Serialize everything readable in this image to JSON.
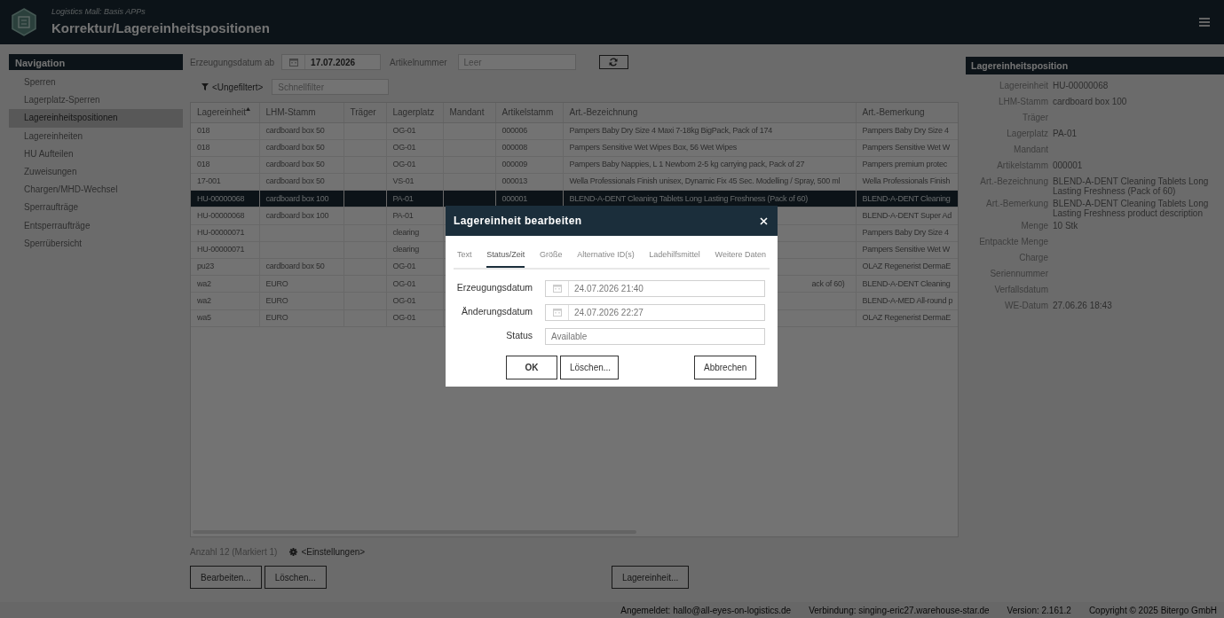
{
  "header": {
    "subtitle": "Logistics Mall: Basis APPs",
    "title": "Korrektur/Lagereinheitspositionen"
  },
  "navigation": {
    "title": "Navigation",
    "items": [
      {
        "label": "Sperren",
        "selected": false
      },
      {
        "label": "Lagerplatz-Sperren",
        "selected": false
      },
      {
        "label": "Lagereinheitspositionen",
        "selected": true
      },
      {
        "label": "Lagereinheiten",
        "selected": false
      },
      {
        "label": "HU Aufteilen",
        "selected": false
      },
      {
        "label": "Zuweisungen",
        "selected": false
      },
      {
        "label": "Chargen/MHD-Wechsel",
        "selected": false
      },
      {
        "label": "Sperraufträge",
        "selected": false
      },
      {
        "label": "Entsperraufträge",
        "selected": false
      },
      {
        "label": "Sperrübersicht",
        "selected": false
      }
    ]
  },
  "filter": {
    "date_label": "Erzeugungsdatum ab",
    "date_value": "17.07.2026",
    "article_label": "Artikelnummer",
    "article_placeholder": "Leer"
  },
  "quick_filter": {
    "link": "<Ungefiltert>",
    "placeholder": "Schnellfilter"
  },
  "table": {
    "columns": [
      {
        "label": "Lagereinheit",
        "sorted": true
      },
      {
        "label": "LHM-Stamm",
        "sorted": false
      },
      {
        "label": "Träger",
        "sorted": false
      },
      {
        "label": "Lagerplatz",
        "sorted": false
      },
      {
        "label": "Mandant",
        "sorted": false
      },
      {
        "label": "Artikelstamm",
        "sorted": false
      },
      {
        "label": "Art.-Bezeichnung",
        "sorted": false
      },
      {
        "label": "Art.-Bemerkung",
        "sorted": false
      }
    ],
    "rows": [
      {
        "selected": false,
        "cells": [
          "018",
          "cardboard box 50",
          null,
          "OG-01",
          null,
          "000006",
          "Pampers Baby Dry Size 4 Maxi 7-18kg BigPack, Pack of 174",
          "Pampers Baby Dry Size 4"
        ]
      },
      {
        "selected": false,
        "cells": [
          "018",
          "cardboard box 50",
          null,
          "OG-01",
          null,
          "000008",
          "Pampers Sensitive Wet Wipes Box, 56 Wet Wipes",
          "Pampers Sensitive Wet W"
        ]
      },
      {
        "selected": false,
        "cells": [
          "018",
          "cardboard box 50",
          null,
          "OG-01",
          null,
          "000009",
          "Pampers Baby Nappies, L 1 Newborn 2-5 kg carrying pack, Pack of 27",
          "Pampers premium protec"
        ]
      },
      {
        "selected": false,
        "cells": [
          "17-001",
          "cardboard box 50",
          null,
          "VS-01",
          null,
          "000013",
          "Wella Professionals Finish unisex, Dynamic Fix 45 Sec. Modelling / Spray, 500 ml",
          "Wella Professionals Finish"
        ]
      },
      {
        "selected": true,
        "cells": [
          "HU-00000068",
          "cardboard box 100",
          null,
          "PA-01",
          null,
          "000001",
          "BLEND-A-DENT Cleaning Tablets Long Lasting Freshness (Pack of 60)",
          "BLEND-A-DENT Cleaning"
        ]
      },
      {
        "selected": false,
        "cells": [
          "HU-00000068",
          "cardboard box 100",
          null,
          "PA-01",
          null,
          null,
          null,
          "BLEND-A-DENT Super Ad"
        ]
      },
      {
        "selected": false,
        "cells": [
          "HU-00000071",
          null,
          null,
          "clearing",
          null,
          null,
          null,
          "Pampers Baby Dry Size 4"
        ]
      },
      {
        "selected": false,
        "cells": [
          "HU-00000071",
          null,
          null,
          "clearing",
          null,
          null,
          null,
          "Pampers Sensitive Wet W"
        ]
      },
      {
        "selected": false,
        "cells": [
          "pu23",
          "cardboard box 50",
          null,
          "OG-01",
          null,
          null,
          null,
          "OLAZ Regenerist DermaE"
        ]
      },
      {
        "selected": false,
        "cells": [
          "wa2",
          "EURO",
          null,
          "OG-01",
          null,
          null,
          {
            "text": "ack of 60)",
            "clipped": true
          },
          "BLEND-A-DENT Cleaning"
        ]
      },
      {
        "selected": false,
        "cells": [
          "wa2",
          "EURO",
          null,
          "OG-01",
          null,
          null,
          null,
          "BLEND-A-MED All-round p"
        ]
      },
      {
        "selected": false,
        "cells": [
          "wa5",
          "EURO",
          null,
          "OG-01",
          null,
          null,
          null,
          "OLAZ Regenerist DermaE"
        ]
      }
    ]
  },
  "summary": {
    "count": "Anzahl 12 (Markiert 1)",
    "settings_link": "<Einstellungen>"
  },
  "actions": [
    {
      "label": "Bearbeiten...",
      "kind": "left"
    },
    {
      "label": "Löschen...",
      "kind": "left"
    },
    {
      "label": "Lagereinheit...",
      "kind": "right"
    }
  ],
  "detail": {
    "title": "Lagereinheitsposition",
    "fields": [
      {
        "label": "Lagereinheit",
        "value": "HU-00000068"
      },
      {
        "label": "LHM-Stamm",
        "value": "cardboard box 100"
      },
      {
        "label": "Träger"
      },
      {
        "label": "Lagerplatz",
        "value": "PA-01"
      },
      {
        "label": "Mandant"
      },
      {
        "label": "Artikelstamm",
        "value": "000001"
      },
      {
        "label": "Art.-Bezeichnung",
        "value": "BLEND-A-DENT Cleaning Tablets Long Lasting Freshness (Pack of 60)"
      },
      {
        "label": "Art.-Bemerkung",
        "value": "BLEND-A-DENT Cleaning Tablets Long Lasting Freshness product description"
      },
      {
        "label": "Menge",
        "value": "10 Stk"
      },
      {
        "label": "Entpackte Menge"
      },
      {
        "label": "Charge"
      },
      {
        "label": "Seriennummer"
      },
      {
        "label": "Verfallsdatum"
      },
      {
        "label": "WE-Datum",
        "value": "27.06.26 18:43"
      }
    ]
  },
  "dialog": {
    "title": "Lagereinheit bearbeiten",
    "tabs": [
      {
        "label": "Text",
        "selected": false
      },
      {
        "label": "Status/Zeit",
        "selected": true
      },
      {
        "label": "Größe",
        "selected": false
      },
      {
        "label": "Alternative ID(s)",
        "selected": false
      },
      {
        "label": "Ladehilfsmittel",
        "selected": false
      },
      {
        "label": "Weitere Daten",
        "selected": false
      }
    ],
    "fields": [
      {
        "kind": "date",
        "label": "Erzeugungsdatum",
        "value": "24.07.2026 21:40"
      },
      {
        "kind": "date",
        "label": "Änderungsdatum",
        "value": "24.07.2026 22:27"
      },
      {
        "kind": "text",
        "label": "Status",
        "value": "Available"
      }
    ],
    "buttons": [
      {
        "label": "OK",
        "kind": "default"
      },
      {
        "label": "Löschen...",
        "kind": "normal"
      },
      {
        "label": "Abbrechen",
        "kind": "cancel"
      }
    ]
  },
  "status_bar": [
    "Angemeldet: hallo@all-eyes-on-logistics.de",
    "Verbindung: singing-eric27.warehouse-star.de",
    "Version: 2.161.2",
    "Copyright © 2025 Bitergo GmbH"
  ]
}
